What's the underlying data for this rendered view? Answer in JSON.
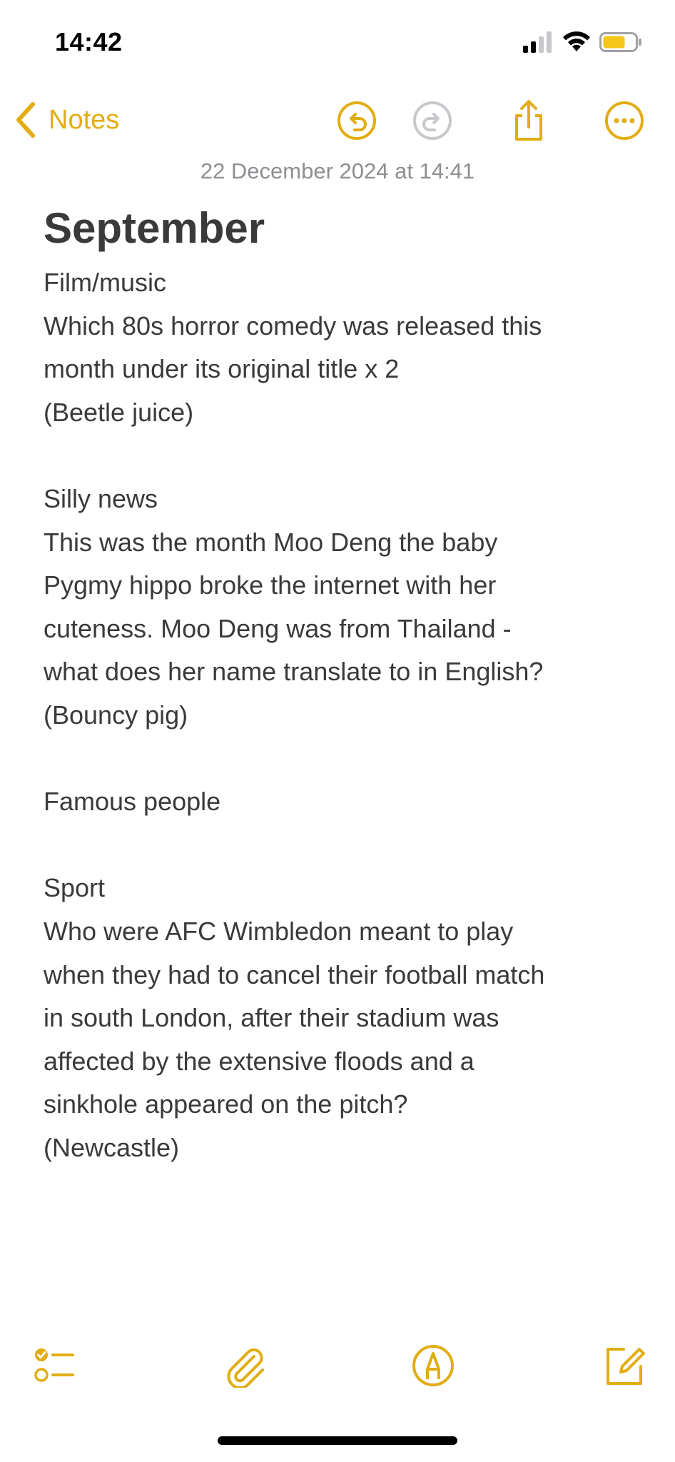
{
  "status_bar": {
    "time": "14:42"
  },
  "nav": {
    "back_label": "Notes",
    "accent_color": "#e2ad12",
    "icons": [
      "chevron-left-icon",
      "undo-icon",
      "redo-icon",
      "share-icon",
      "more-icon"
    ]
  },
  "note": {
    "date": "22 December 2024 at 14:41",
    "title": "September",
    "lines": [
      "Film/music",
      "Which 80s horror comedy was released this",
      "month under its original title x 2",
      "(Beetle juice)",
      "",
      "Silly news",
      "This was the month Moo Deng the baby",
      "Pygmy hippo broke the internet with her",
      "cuteness. Moo Deng was from Thailand -",
      "what does her name translate to in English?",
      "(Bouncy pig)",
      "",
      "Famous people",
      "",
      "Sport",
      "Who were AFC Wimbledon meant to play",
      "when they had to cancel their football match",
      "in south London, after their stadium was",
      "affected by the extensive floods and a",
      "sinkhole appeared on the pitch?",
      "(Newcastle)"
    ]
  },
  "toolbar": {
    "icons": [
      "checklist-icon",
      "paperclip-icon",
      "markup-pen-icon",
      "compose-icon"
    ]
  }
}
